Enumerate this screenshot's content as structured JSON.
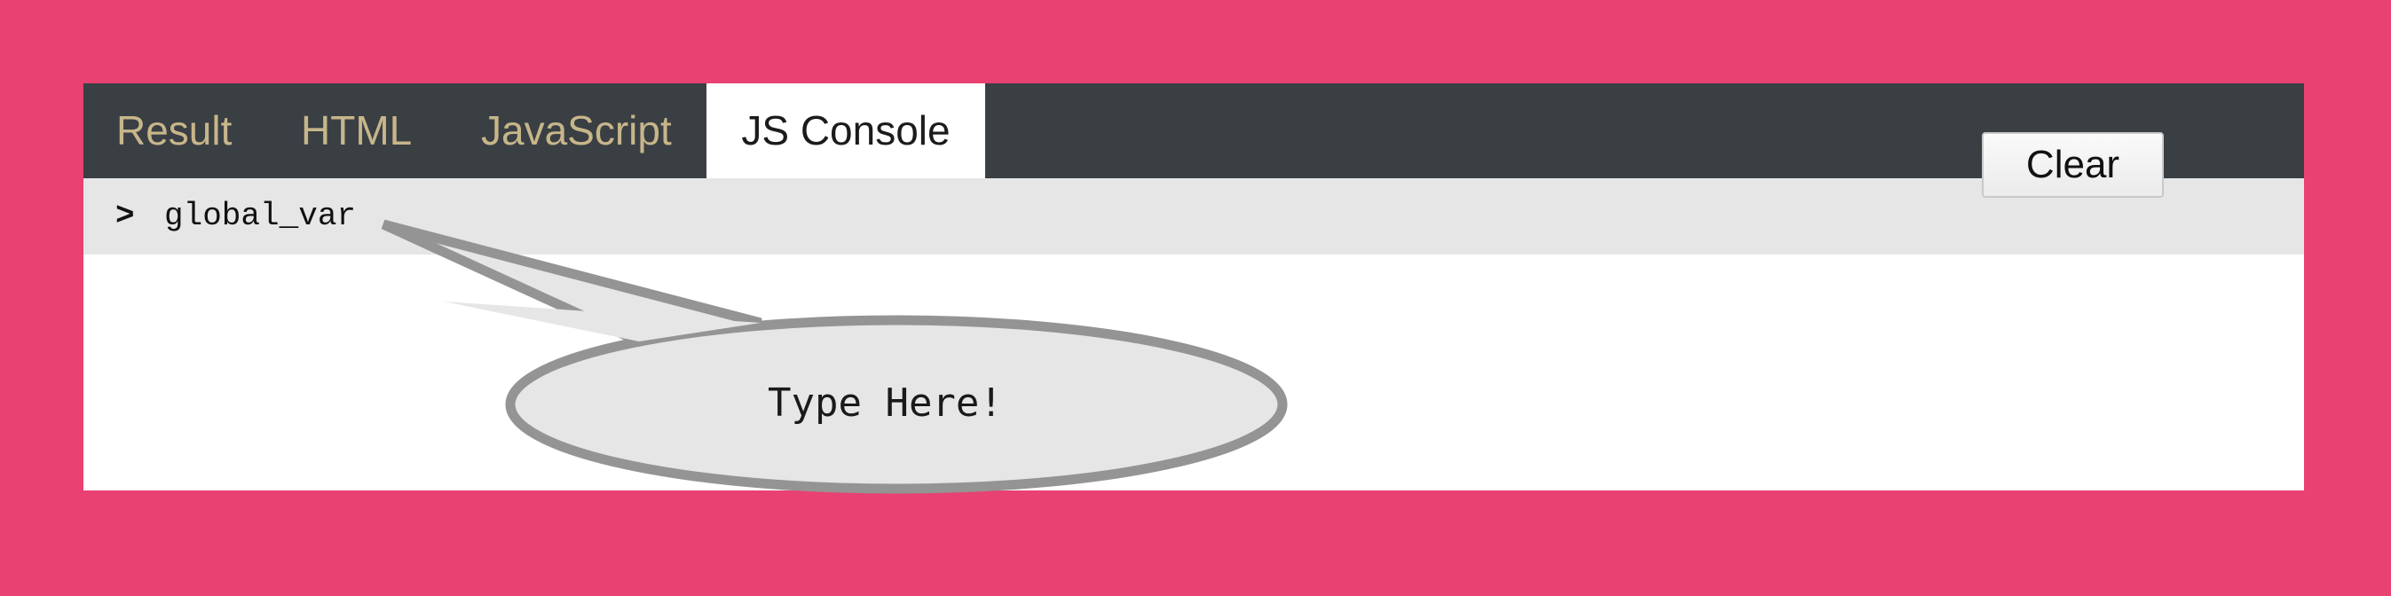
{
  "tabs": [
    {
      "label": "Result",
      "active": false
    },
    {
      "label": "HTML",
      "active": false
    },
    {
      "label": "JavaScript",
      "active": false
    },
    {
      "label": "JS Console",
      "active": true
    }
  ],
  "console": {
    "prompt": ">",
    "command": "global_var",
    "clear_label": "Clear"
  },
  "callout": {
    "text": "Type Here!"
  },
  "colors": {
    "background": "#e84172",
    "tabbar": "#3a3f44",
    "tab_inactive_text": "#c7b68a",
    "console_input_bg": "#e6e6e6",
    "bubble_fill": "#e6e6e6",
    "bubble_stroke": "#949494"
  }
}
